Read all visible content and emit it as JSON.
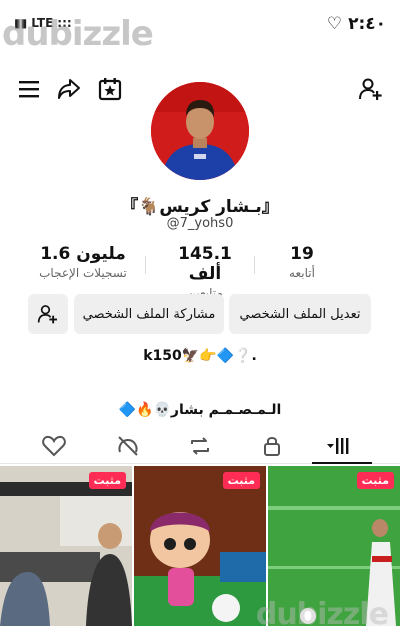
{
  "status_bar": {
    "network": "LTE",
    "time": "٢:٤٠"
  },
  "watermark": "dubizzle",
  "profile": {
    "display_name": "『بـشار كريس🐐』",
    "username": "@7_yohs0"
  },
  "stats": {
    "following": {
      "value": "19",
      "label": "أتابعه"
    },
    "followers": {
      "value": "145.1 ألف",
      "label": "متابعين"
    },
    "likes": {
      "value": "1.6 مليون",
      "label": "تسجيلات الإعجاب"
    }
  },
  "actions": {
    "edit_profile": "تعديل الملف الشخصي",
    "share_profile": "مشاركة الملف الشخصي"
  },
  "bio": {
    "line1": "k150🦅👉🔷❔.",
    "line2": "الـمـصـمـم بشار💀🔥🔷"
  },
  "pinned_label": "مثبت",
  "videos": [
    {
      "caption": "مثبت"
    },
    {
      "caption": "مثبت"
    },
    {
      "caption": "مثبت"
    }
  ]
}
